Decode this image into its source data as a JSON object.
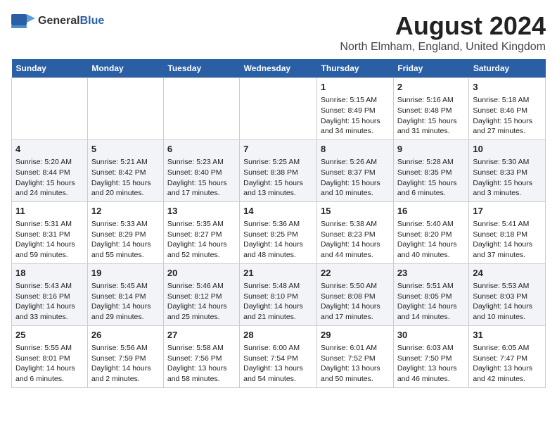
{
  "logo": {
    "general": "General",
    "blue": "Blue"
  },
  "title": "August 2024",
  "location": "North Elmham, England, United Kingdom",
  "weekdays": [
    "Sunday",
    "Monday",
    "Tuesday",
    "Wednesday",
    "Thursday",
    "Friday",
    "Saturday"
  ],
  "weeks": [
    [
      {
        "day": "",
        "info": ""
      },
      {
        "day": "",
        "info": ""
      },
      {
        "day": "",
        "info": ""
      },
      {
        "day": "",
        "info": ""
      },
      {
        "day": "1",
        "info": "Sunrise: 5:15 AM\nSunset: 8:49 PM\nDaylight: 15 hours and 34 minutes."
      },
      {
        "day": "2",
        "info": "Sunrise: 5:16 AM\nSunset: 8:48 PM\nDaylight: 15 hours and 31 minutes."
      },
      {
        "day": "3",
        "info": "Sunrise: 5:18 AM\nSunset: 8:46 PM\nDaylight: 15 hours and 27 minutes."
      }
    ],
    [
      {
        "day": "4",
        "info": "Sunrise: 5:20 AM\nSunset: 8:44 PM\nDaylight: 15 hours and 24 minutes."
      },
      {
        "day": "5",
        "info": "Sunrise: 5:21 AM\nSunset: 8:42 PM\nDaylight: 15 hours and 20 minutes."
      },
      {
        "day": "6",
        "info": "Sunrise: 5:23 AM\nSunset: 8:40 PM\nDaylight: 15 hours and 17 minutes."
      },
      {
        "day": "7",
        "info": "Sunrise: 5:25 AM\nSunset: 8:38 PM\nDaylight: 15 hours and 13 minutes."
      },
      {
        "day": "8",
        "info": "Sunrise: 5:26 AM\nSunset: 8:37 PM\nDaylight: 15 hours and 10 minutes."
      },
      {
        "day": "9",
        "info": "Sunrise: 5:28 AM\nSunset: 8:35 PM\nDaylight: 15 hours and 6 minutes."
      },
      {
        "day": "10",
        "info": "Sunrise: 5:30 AM\nSunset: 8:33 PM\nDaylight: 15 hours and 3 minutes."
      }
    ],
    [
      {
        "day": "11",
        "info": "Sunrise: 5:31 AM\nSunset: 8:31 PM\nDaylight: 14 hours and 59 minutes."
      },
      {
        "day": "12",
        "info": "Sunrise: 5:33 AM\nSunset: 8:29 PM\nDaylight: 14 hours and 55 minutes."
      },
      {
        "day": "13",
        "info": "Sunrise: 5:35 AM\nSunset: 8:27 PM\nDaylight: 14 hours and 52 minutes."
      },
      {
        "day": "14",
        "info": "Sunrise: 5:36 AM\nSunset: 8:25 PM\nDaylight: 14 hours and 48 minutes."
      },
      {
        "day": "15",
        "info": "Sunrise: 5:38 AM\nSunset: 8:23 PM\nDaylight: 14 hours and 44 minutes."
      },
      {
        "day": "16",
        "info": "Sunrise: 5:40 AM\nSunset: 8:20 PM\nDaylight: 14 hours and 40 minutes."
      },
      {
        "day": "17",
        "info": "Sunrise: 5:41 AM\nSunset: 8:18 PM\nDaylight: 14 hours and 37 minutes."
      }
    ],
    [
      {
        "day": "18",
        "info": "Sunrise: 5:43 AM\nSunset: 8:16 PM\nDaylight: 14 hours and 33 minutes."
      },
      {
        "day": "19",
        "info": "Sunrise: 5:45 AM\nSunset: 8:14 PM\nDaylight: 14 hours and 29 minutes."
      },
      {
        "day": "20",
        "info": "Sunrise: 5:46 AM\nSunset: 8:12 PM\nDaylight: 14 hours and 25 minutes."
      },
      {
        "day": "21",
        "info": "Sunrise: 5:48 AM\nSunset: 8:10 PM\nDaylight: 14 hours and 21 minutes."
      },
      {
        "day": "22",
        "info": "Sunrise: 5:50 AM\nSunset: 8:08 PM\nDaylight: 14 hours and 17 minutes."
      },
      {
        "day": "23",
        "info": "Sunrise: 5:51 AM\nSunset: 8:05 PM\nDaylight: 14 hours and 14 minutes."
      },
      {
        "day": "24",
        "info": "Sunrise: 5:53 AM\nSunset: 8:03 PM\nDaylight: 14 hours and 10 minutes."
      }
    ],
    [
      {
        "day": "25",
        "info": "Sunrise: 5:55 AM\nSunset: 8:01 PM\nDaylight: 14 hours and 6 minutes."
      },
      {
        "day": "26",
        "info": "Sunrise: 5:56 AM\nSunset: 7:59 PM\nDaylight: 14 hours and 2 minutes."
      },
      {
        "day": "27",
        "info": "Sunrise: 5:58 AM\nSunset: 7:56 PM\nDaylight: 13 hours and 58 minutes."
      },
      {
        "day": "28",
        "info": "Sunrise: 6:00 AM\nSunset: 7:54 PM\nDaylight: 13 hours and 54 minutes."
      },
      {
        "day": "29",
        "info": "Sunrise: 6:01 AM\nSunset: 7:52 PM\nDaylight: 13 hours and 50 minutes."
      },
      {
        "day": "30",
        "info": "Sunrise: 6:03 AM\nSunset: 7:50 PM\nDaylight: 13 hours and 46 minutes."
      },
      {
        "day": "31",
        "info": "Sunrise: 6:05 AM\nSunset: 7:47 PM\nDaylight: 13 hours and 42 minutes."
      }
    ]
  ]
}
